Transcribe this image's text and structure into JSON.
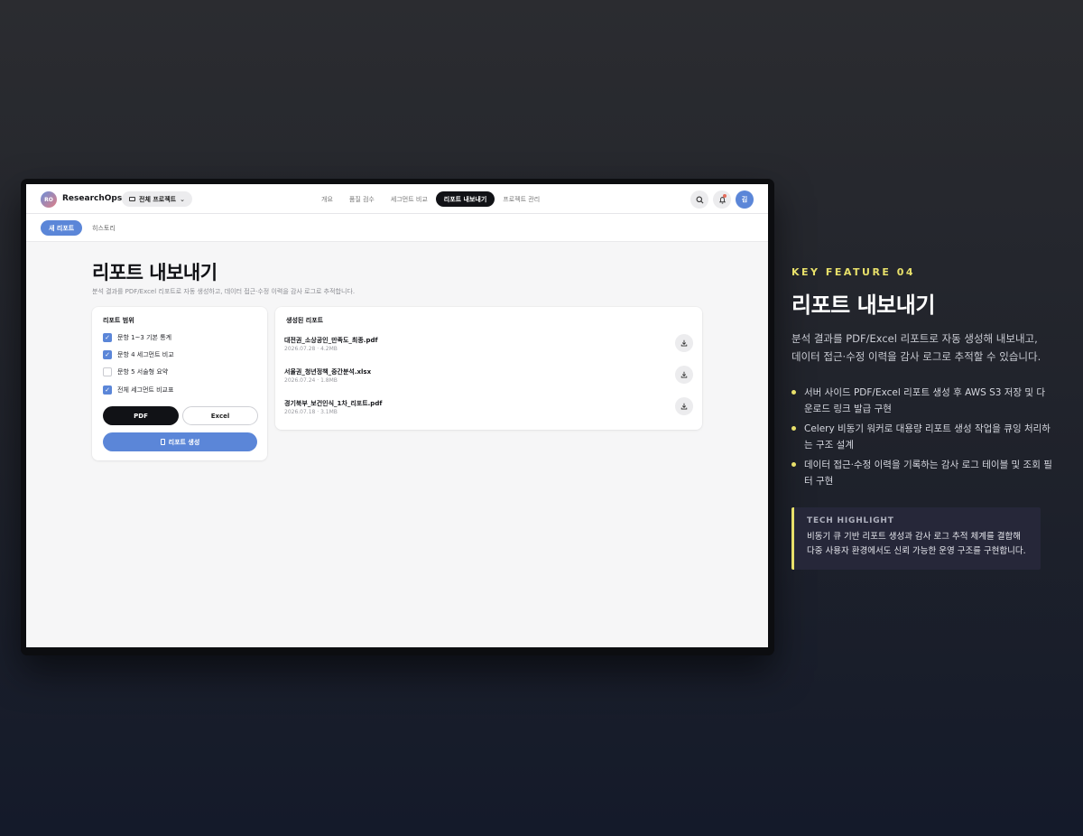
{
  "app": {
    "logo_initials": "RO",
    "brand": "ResearchOps",
    "project_selector": "전체 프로젝트",
    "nav_tabs": [
      {
        "label": "개요",
        "active": false
      },
      {
        "label": "품질 검수",
        "active": false
      },
      {
        "label": "세그먼트 비교",
        "active": false
      },
      {
        "label": "리포트 내보내기",
        "active": true
      },
      {
        "label": "프로젝트 관리",
        "active": false
      }
    ],
    "user_initial": "김",
    "sub_tabs": [
      {
        "label": "새 리포트",
        "active": true
      },
      {
        "label": "히스토리",
        "active": false
      }
    ],
    "page_title": "리포트 내보내기",
    "page_desc": "분석 결과를 PDF/Excel 리포트로 자동 생성하고, 데이터 접근·수정 이력을 감사 로그로 추적합니다.",
    "scope_card": {
      "title": "리포트 범위",
      "options": [
        {
          "label": "문항 1~3 기본 통계",
          "checked": true
        },
        {
          "label": "문항 4 세그먼트 비교",
          "checked": true
        },
        {
          "label": "문항 5 서술형 요약",
          "checked": false
        },
        {
          "label": "전체 세그먼트 비교표",
          "checked": true
        }
      ],
      "format_pdf": "PDF",
      "format_excel": "Excel",
      "generate_button": "리포트 생성"
    },
    "reports_card": {
      "title": "생성된 리포트",
      "items": [
        {
          "name": "대전권_소상공인_만족도_최종.pdf",
          "meta": "2026.07.28 · 4.2MB"
        },
        {
          "name": "서울권_청년정책_중간분석.xlsx",
          "meta": "2026.07.24 · 1.8MB"
        },
        {
          "name": "경기북부_보건인식_1차_리포트.pdf",
          "meta": "2026.07.18 · 3.1MB"
        }
      ]
    }
  },
  "feature": {
    "kicker": "KEY FEATURE 04",
    "title": "리포트 내보내기",
    "desc_line1": "분석 결과를 PDF/Excel 리포트로 자동 생성해 내보내고,",
    "desc_line2": "데이터 접근·수정 이력을 감사 로그로 추적할 수 있습니다.",
    "bullets": [
      "서버 사이드 PDF/Excel 리포트 생성 후 AWS S3 저장 및 다운로드 링크 발급 구현",
      "Celery 비동기 워커로 대용량 리포트 생성 작업을 큐잉 처리하는 구조 설계",
      "데이터 접근·수정 이력을 기록하는 감사 로그 테이블 및 조회 필터 구현"
    ],
    "tech_label": "TECH HIGHLIGHT",
    "tech_text": "비동기 큐 기반 리포트 생성과 감사 로그 추적 체계를 결합해 다중 사용자 환경에서도 신뢰 가능한 운영 구조를 구현합니다."
  },
  "colors": {
    "accent_blue": "#5b86d8",
    "accent_yellow": "#e8e06a",
    "dark": "#111216"
  },
  "icons": {
    "project_selector": "folder-icon",
    "search": "search-icon",
    "notifications": "bell-icon",
    "download": "download-icon",
    "generate": "document-icon"
  }
}
